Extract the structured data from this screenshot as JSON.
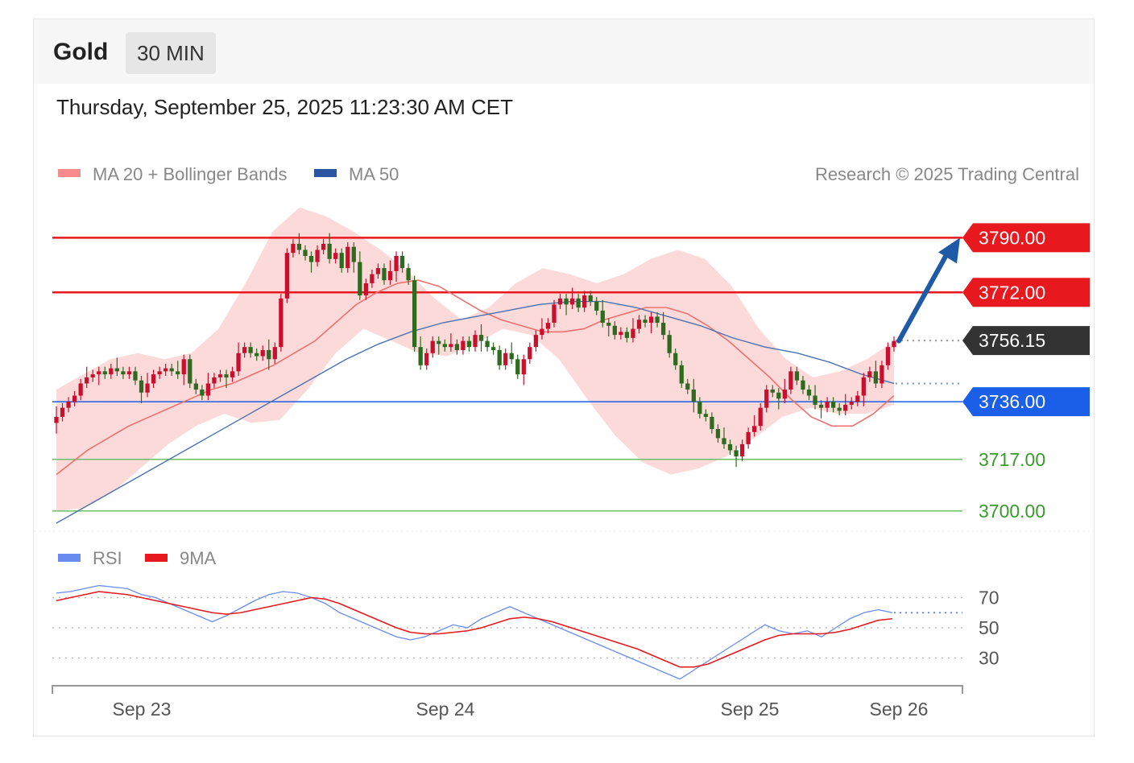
{
  "header": {
    "title": "Gold",
    "interval": "30 MIN",
    "timestamp": "Thursday, September 25, 2025 11:23:30 AM CET"
  },
  "legend": {
    "bollinger": "MA 20 + Bollinger Bands",
    "ma50": "MA 50",
    "credit": "Research © 2025 Trading Central",
    "rsi": "RSI",
    "rsi_ma": "9MA"
  },
  "colors": {
    "up": "#c8102e",
    "down": "#2e6b1f",
    "resistance": "#e8191e",
    "pivot": "#1b5ee8",
    "support": "#6fbf6a",
    "support_text": "#3a9a2c",
    "current": "#333333",
    "ma20": "#f07070",
    "band_fill": "#fbd4d4",
    "ma50": "#4a72b0",
    "arrow": "#1f5aa6",
    "rsi": "#6a8cf0",
    "rsi_ma": "#e8191e"
  },
  "chart_data": [
    {
      "type": "candlestick",
      "title": "Gold",
      "interval": "30 MIN",
      "x_labels": [
        "Sep 23",
        "Sep 24",
        "Sep 25",
        "Sep 26"
      ],
      "ylim": [
        3696,
        3806
      ],
      "levels": [
        {
          "role": "resistance",
          "value": 3790.0,
          "label": "3790.00"
        },
        {
          "role": "resistance",
          "value": 3772.0,
          "label": "3772.00"
        },
        {
          "role": "current",
          "value": 3756.15,
          "label": "3756.15"
        },
        {
          "role": "pivot",
          "value": 3736.0,
          "label": "3736.00"
        },
        {
          "role": "support",
          "value": 3717.0,
          "label": "3717.00"
        },
        {
          "role": "support",
          "value": 3700.0,
          "label": "3700.00"
        }
      ],
      "close": [
        3731,
        3734,
        3736,
        3738,
        3742,
        3744,
        3745,
        3746,
        3745,
        3747,
        3746,
        3745,
        3746,
        3743,
        3739,
        3742,
        3745,
        3746,
        3747,
        3746,
        3745,
        3750,
        3742,
        3740,
        3738,
        3742,
        3744,
        3745,
        3744,
        3746,
        3752,
        3754,
        3752,
        3751,
        3753,
        3750,
        3754,
        3770,
        3785,
        3788,
        3786,
        3784,
        3782,
        3786,
        3788,
        3783,
        3785,
        3780,
        3787,
        3782,
        3771,
        3775,
        3778,
        3780,
        3776,
        3779,
        3784,
        3780,
        3776,
        3754,
        3748,
        3752,
        3756,
        3755,
        3754,
        3755,
        3753,
        3756,
        3754,
        3758,
        3756,
        3754,
        3753,
        3748,
        3752,
        3750,
        3745,
        3750,
        3754,
        3758,
        3760,
        3762,
        3768,
        3770,
        3768,
        3770,
        3767,
        3771,
        3769,
        3766,
        3762,
        3761,
        3758,
        3759,
        3757,
        3760,
        3763,
        3762,
        3764,
        3762,
        3758,
        3752,
        3748,
        3742,
        3740,
        3736,
        3732,
        3731,
        3727,
        3724,
        3722,
        3720,
        3718,
        3722,
        3726,
        3728,
        3734,
        3740,
        3739,
        3737,
        3740,
        3746,
        3743,
        3740,
        3738,
        3735,
        3734,
        3736,
        3734,
        3733,
        3735,
        3736,
        3738,
        3744,
        3746,
        3742,
        3748,
        3754,
        3756
      ],
      "ma20": [
        3712,
        3716,
        3720,
        3724,
        3728,
        3731,
        3734,
        3737,
        3740,
        3742,
        3745,
        3748,
        3752,
        3756,
        3762,
        3768,
        3772,
        3775,
        3776,
        3774,
        3770,
        3766,
        3763,
        3761,
        3759,
        3759,
        3760,
        3763,
        3765,
        3767,
        3767,
        3765,
        3761,
        3756,
        3750,
        3744,
        3737,
        3731,
        3728,
        3728,
        3732,
        3738
      ],
      "ma20_x": [
        0,
        3,
        6,
        10,
        14,
        18,
        22,
        26,
        30,
        34,
        38,
        42,
        46,
        50,
        54,
        58,
        62,
        66,
        70,
        74,
        78,
        82,
        86,
        90,
        94,
        98,
        102,
        106,
        110,
        114,
        118,
        122,
        126,
        130,
        134,
        138,
        142,
        146,
        150,
        154,
        158,
        162
      ],
      "bb_upper": [
        3740,
        3745,
        3750,
        3752,
        3750,
        3752,
        3760,
        3775,
        3792,
        3800,
        3797,
        3792,
        3786,
        3779,
        3770,
        3763,
        3767,
        3775,
        3780,
        3778,
        3775,
        3778,
        3783,
        3786,
        3783,
        3774,
        3760,
        3750,
        3744,
        3746,
        3750,
        3756
      ],
      "bb_lower": [
        3700,
        3701,
        3706,
        3714,
        3722,
        3728,
        3732,
        3729,
        3730,
        3740,
        3752,
        3760,
        3756,
        3752,
        3751,
        3755,
        3760,
        3758,
        3750,
        3737,
        3725,
        3716,
        3712,
        3714,
        3718,
        3724,
        3731,
        3734,
        3732,
        3732,
        3735
      ],
      "ma50": [
        3696,
        3702,
        3708,
        3714,
        3720,
        3726,
        3732,
        3738,
        3744,
        3750,
        3755,
        3759,
        3762,
        3764,
        3766,
        3768,
        3769,
        3769,
        3767,
        3764,
        3761,
        3757,
        3754,
        3752,
        3749,
        3745,
        3742
      ],
      "projection": {
        "from": 3756,
        "to": 3790
      }
    },
    {
      "type": "line",
      "title": "RSI",
      "yticks": [
        70,
        50,
        30
      ],
      "ylim": [
        10,
        90
      ],
      "series": [
        {
          "name": "RSI",
          "values": [
            73,
            74,
            76,
            78,
            77,
            76,
            72,
            70,
            66,
            62,
            58,
            54,
            58,
            63,
            68,
            72,
            74,
            73,
            70,
            66,
            60,
            56,
            52,
            48,
            44,
            42,
            44,
            48,
            52,
            50,
            56,
            60,
            64,
            60,
            56,
            52,
            48,
            44,
            40,
            36,
            32,
            28,
            24,
            20,
            16,
            22,
            28,
            34,
            40,
            46,
            52,
            48,
            46,
            48,
            44,
            50,
            56,
            60,
            62,
            60
          ]
        },
        {
          "name": "9MA",
          "values": [
            68,
            70,
            72,
            74,
            73,
            72,
            70,
            68,
            66,
            64,
            62,
            60,
            59,
            60,
            62,
            64,
            66,
            68,
            70,
            69,
            66,
            62,
            58,
            54,
            50,
            47,
            46,
            46,
            47,
            48,
            50,
            53,
            56,
            57,
            56,
            54,
            51,
            48,
            45,
            42,
            39,
            36,
            32,
            28,
            24,
            24,
            26,
            30,
            34,
            38,
            42,
            45,
            46,
            46,
            46,
            47,
            49,
            52,
            55,
            56
          ]
        }
      ]
    }
  ]
}
